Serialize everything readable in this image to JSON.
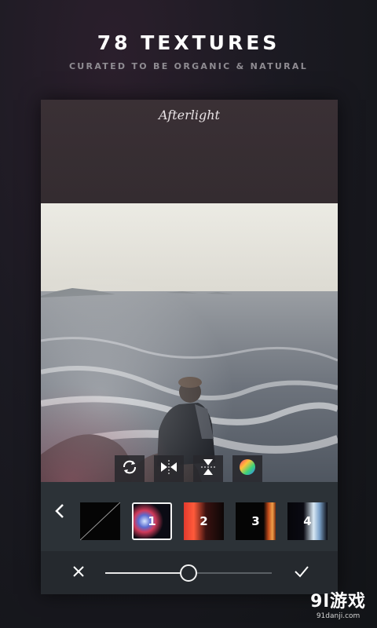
{
  "hero": {
    "title": "78 TEXTURES",
    "subtitle": "CURATED TO BE ORGANIC & NATURAL"
  },
  "app": {
    "brand": "Afterlight"
  },
  "toolbar": {
    "tools": [
      {
        "icon": "rotate-icon"
      },
      {
        "icon": "flip-horizontal-icon"
      },
      {
        "icon": "flip-vertical-icon"
      },
      {
        "icon": "color-wheel-icon"
      }
    ]
  },
  "textures": {
    "back_icon": "chevron-left-icon",
    "items": [
      {
        "label": ""
      },
      {
        "label": "1"
      },
      {
        "label": "2"
      },
      {
        "label": "3"
      },
      {
        "label": "4"
      }
    ],
    "selected_index": 1
  },
  "controls": {
    "cancel_icon": "close-icon",
    "confirm_icon": "checkmark-icon",
    "slider_value": 0.5
  },
  "watermark": {
    "main": "9l游戏",
    "sub": "91danji.com"
  }
}
